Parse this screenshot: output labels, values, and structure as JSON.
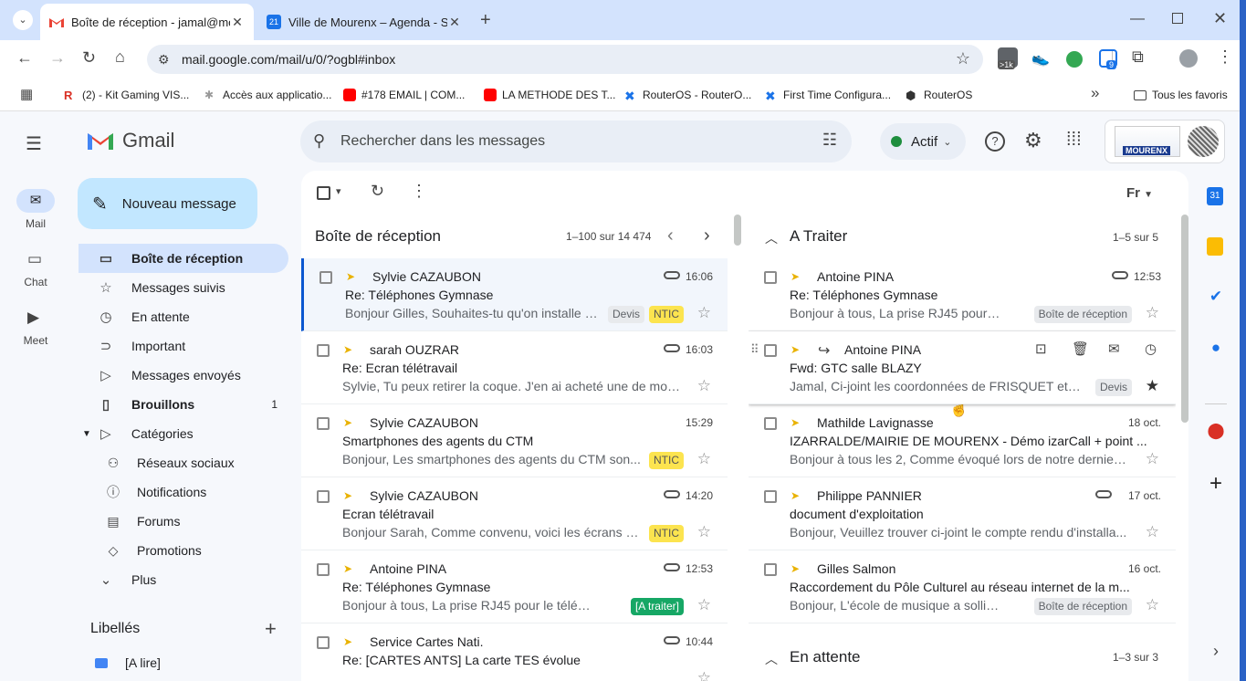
{
  "browser": {
    "tabs": [
      {
        "title": "Boîte de réception - jamal@mo",
        "active": true
      },
      {
        "title": "Ville de Mourenx – Agenda - Se",
        "active": false
      }
    ],
    "new_tab": "+",
    "url": "mail.google.com/mail/u/0/?ogbl#inbox",
    "ext_badge_1": ">1k",
    "ext_badge_2": "9",
    "bookmarks": [
      {
        "label": "(2) - Kit Gaming VIS..."
      },
      {
        "label": "Accès aux applicatio..."
      },
      {
        "label": "#178 EMAIL | COM..."
      },
      {
        "label": "LA METHODE DES T..."
      },
      {
        "label": "RouterOS - RouterO..."
      },
      {
        "label": "First Time Configura..."
      },
      {
        "label": "RouterOS"
      }
    ],
    "bookmarks_more": "»",
    "all_bookmarks": "Tous les favoris"
  },
  "gmail": {
    "logo": "Gmail",
    "search_placeholder": "Rechercher dans les messages",
    "status": "Actif",
    "rail": [
      {
        "label": "Mail",
        "icon": "mail-icon"
      },
      {
        "label": "Chat",
        "icon": "chat-icon"
      },
      {
        "label": "Meet",
        "icon": "meet-icon"
      }
    ],
    "compose": "Nouveau message",
    "nav": [
      {
        "label": "Boîte de réception",
        "active": true
      },
      {
        "label": "Messages suivis"
      },
      {
        "label": "En attente"
      },
      {
        "label": "Important"
      },
      {
        "label": "Messages envoyés"
      },
      {
        "label": "Brouillons",
        "count": "1"
      },
      {
        "label": "Catégories"
      }
    ],
    "categories": [
      {
        "label": "Réseaux sociaux"
      },
      {
        "label": "Notifications"
      },
      {
        "label": "Forums"
      },
      {
        "label": "Promotions"
      }
    ],
    "more": "Plus",
    "labels_title": "Libellés",
    "labels": [
      {
        "label": "[A lire]",
        "color": "#4285f4"
      }
    ],
    "inbox_title": "Boîte de réception",
    "inbox_range": "1–100 sur 14 474",
    "inbox": [
      {
        "sender": "Sylvie CAZAUBON",
        "time": "16:06",
        "clip": true,
        "subject": "Re: Téléphones Gymnase",
        "snippet": "Bonjour Gilles, Souhaites-tu qu'on installe l...",
        "labels": [
          {
            "t": "Devis",
            "c": "grey"
          },
          {
            "t": "NTIC",
            "c": "yellow"
          }
        ],
        "read": false
      },
      {
        "sender": "sarah OUZRAR",
        "time": "16:03",
        "clip": true,
        "subject": "Re: Ecran télétravail",
        "snippet": "Sylvie, Tu peux retirer la coque. J'en ai acheté une de mon...",
        "labels": [],
        "read": false
      },
      {
        "sender": "Sylvie CAZAUBON",
        "time": "15:29",
        "clip": false,
        "subject": "Smartphones des agents du CTM",
        "snippet": "Bonjour, Les smartphones des agents du CTM son...",
        "labels": [
          {
            "t": "NTIC",
            "c": "yellow"
          }
        ],
        "read": false
      },
      {
        "sender": "Sylvie CAZAUBON",
        "time": "14:20",
        "clip": true,
        "subject": "Ecran télétravail",
        "snippet": "Bonjour Sarah, Comme convenu, voici les écrans q...",
        "labels": [
          {
            "t": "NTIC",
            "c": "yellow"
          }
        ],
        "read": false
      },
      {
        "sender": "Antoine PINA",
        "time": "12:53",
        "clip": true,
        "subject": "Re: Téléphones Gymnase",
        "snippet": "Bonjour à tous, La prise RJ45 pour le téléphon...",
        "labels": [
          {
            "t": "[A traiter]",
            "c": "green"
          }
        ],
        "read": false
      },
      {
        "sender": "Service Cartes Nati.",
        "time": "10:44",
        "clip": true,
        "subject": "Re: [CARTES ANTS] La carte TES évolue",
        "snippet": "",
        "labels": [],
        "read": false
      }
    ],
    "traiter_title": "A Traiter",
    "traiter_range": "1–5 sur 5",
    "traiter": [
      {
        "sender": "Antoine PINA",
        "time": "12:53",
        "clip": true,
        "subject": "Re: Téléphones Gymnase",
        "snippet": "Bonjour à tous, La prise RJ45 pour le t...",
        "labels": [
          {
            "t": "Boîte de réception",
            "c": "grey"
          }
        ]
      },
      {
        "sender": "Antoine PINA",
        "time": "",
        "clip": false,
        "subject": "Fwd: GTC salle BLAZY",
        "snippet": "Jamal, Ci-joint les coordonnées de FRISQUET et l...",
        "labels": [
          {
            "t": "Devis",
            "c": "grey"
          }
        ],
        "hover": true
      },
      {
        "sender": "Mathilde Lavignasse",
        "time": "18 oct.",
        "clip": false,
        "subject": "IZARRALDE/MAIRIE DE MOURENX - Démo izarCall + point ...",
        "snippet": "Bonjour à tous les 2, Comme évoqué lors de notre dernier ...",
        "labels": []
      },
      {
        "sender": "Philippe PANNIER",
        "time": "17 oct.",
        "clip": true,
        "subject": "document d'exploitation",
        "snippet": "Bonjour, Veuillez trouver ci-joint le compte rendu d'installa...",
        "labels": []
      },
      {
        "sender": "Gilles Salmon",
        "time": "16 oct.",
        "clip": false,
        "subject": "Raccordement du Pôle Culturel au réseau internet de la m...",
        "snippet": "Bonjour, L'école de musique a sollicité ...",
        "labels": [
          {
            "t": "Boîte de réception",
            "c": "grey"
          }
        ]
      }
    ],
    "attente_title": "En attente",
    "attente_range": "1–3 sur 3",
    "density_btn": "Fr",
    "logo_text": "MOURENX"
  },
  "colors": {
    "accent": "#0b57d0",
    "selected_nav": "#d3e3fd",
    "importance": "#e9b200",
    "label_yellow": "#fce44f",
    "label_green": "#16a765"
  }
}
